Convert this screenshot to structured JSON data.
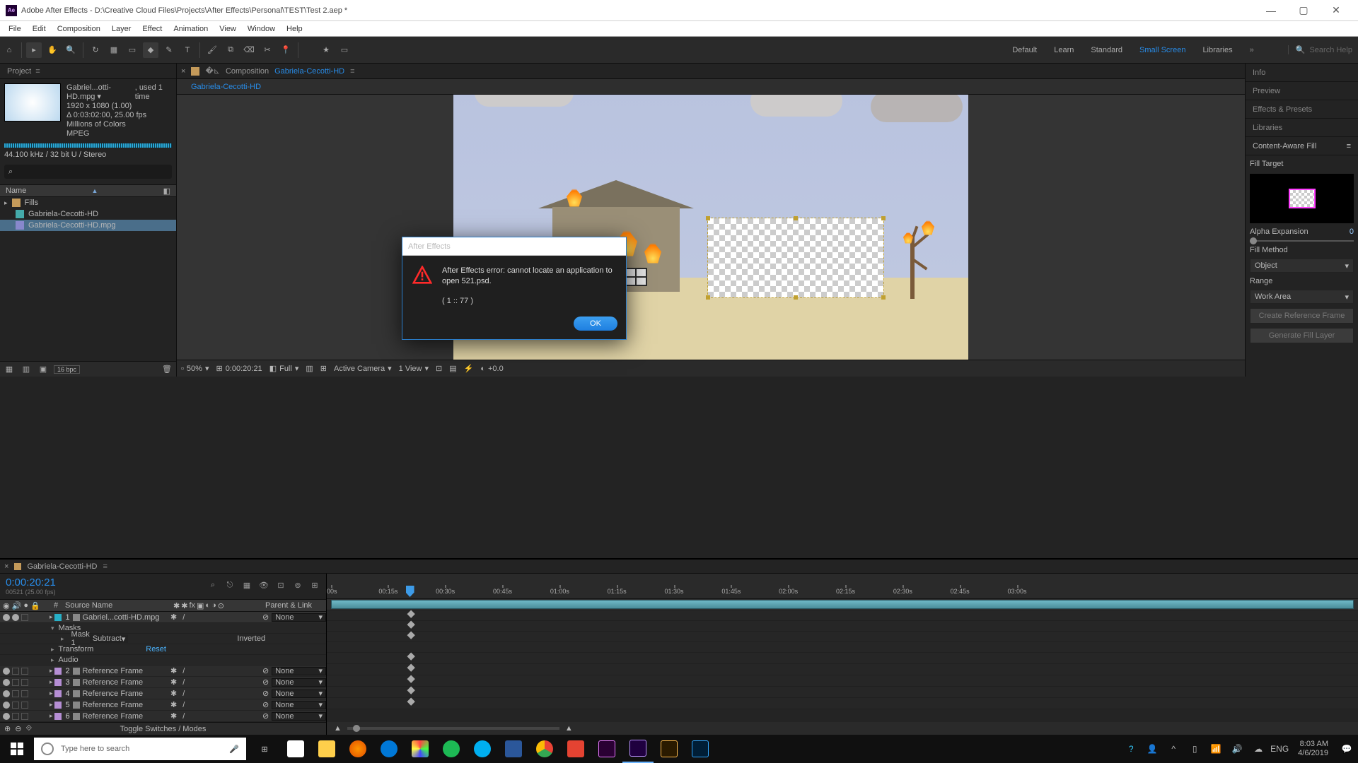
{
  "window_title": "Adobe After Effects - D:\\Creative Cloud Files\\Projects\\After Effects\\Personal\\TEST\\Test 2.aep *",
  "menu": [
    "File",
    "Edit",
    "Composition",
    "Layer",
    "Effect",
    "Animation",
    "View",
    "Window",
    "Help"
  ],
  "workspaces": [
    "Default",
    "Learn",
    "Standard",
    "Small Screen",
    "Libraries"
  ],
  "workspace_active": "Small Screen",
  "search_help_placeholder": "Search Help",
  "project": {
    "panel": "Project",
    "asset": {
      "name": "Gabriel...otti-HD.mpg ▾",
      "used": ", used 1 time",
      "res": "1920 x 1080 (1.00)",
      "dur": "Δ 0:03:02:00, 25.00 fps",
      "colors": "Millions of Colors",
      "codec": "MPEG",
      "audio": "44.100 kHz / 32 bit U / Stereo"
    },
    "search_placeholder": "",
    "col_name": "Name",
    "items": [
      {
        "type": "folder",
        "label": "Fills"
      },
      {
        "type": "comp",
        "label": "Gabriela-Cecotti-HD"
      },
      {
        "type": "mpg",
        "label": "Gabriela-Cecotti-HD.mpg"
      }
    ],
    "bpc": "16 bpc"
  },
  "composition": {
    "label": "Composition",
    "name": "Gabriela-Cecotti-HD",
    "tab": "Gabriela-Cecotti-HD"
  },
  "viewer_footer": {
    "zoom": "50%",
    "time": "0:00:20:21",
    "res": "Full",
    "camera": "Active Camera",
    "view": "1 View",
    "exposure": "+0.0"
  },
  "side_panels": [
    "Info",
    "Preview",
    "Effects & Presets",
    "Libraries"
  ],
  "caf": {
    "title": "Content-Aware Fill",
    "fill_target": "Fill Target",
    "alpha_label": "Alpha Expansion",
    "alpha_value": "0",
    "fill_method": "Fill Method",
    "fill_method_value": "Object",
    "range": "Range",
    "range_value": "Work Area",
    "btn1": "Create Reference Frame",
    "btn2": "Generate Fill Layer"
  },
  "timeline": {
    "tab": "Gabriela-Cecotti-HD",
    "timecode": "0:00:20:21",
    "timecode_sub": "00521 (25.00 fps)",
    "col_source": "Source Name",
    "col_parent": "Parent & Link",
    "toggle_label": "Toggle Switches / Modes",
    "layers": [
      {
        "n": "1",
        "name": "Gabriel...cotti-HD.mpg",
        "color": "c",
        "parent": "None",
        "sel": true
      },
      {
        "n": "2",
        "name": "Reference Frame",
        "color": "p",
        "parent": "None"
      },
      {
        "n": "3",
        "name": "Reference Frame",
        "color": "p",
        "parent": "None"
      },
      {
        "n": "4",
        "name": "Reference Frame",
        "color": "p",
        "parent": "None"
      },
      {
        "n": "5",
        "name": "Reference Frame",
        "color": "p",
        "parent": "None"
      },
      {
        "n": "6",
        "name": "Reference Frame",
        "color": "p",
        "parent": "None"
      }
    ],
    "sub": {
      "masks": "Masks",
      "mask1": "Mask 1",
      "mask_mode": "Subtract",
      "mask_inv": "Inverted",
      "transform": "Transform",
      "reset": "Reset",
      "audio": "Audio"
    },
    "ruler": [
      ":00s",
      "00:15s",
      "00:30s",
      "00:45s",
      "01:00s",
      "01:15s",
      "01:30s",
      "01:45s",
      "02:00s",
      "02:15s",
      "02:30s",
      "02:45s",
      "03:00s"
    ]
  },
  "dialog": {
    "title": "After Effects",
    "message": "After Effects error: cannot locate an application to open 521.psd.",
    "code": "( 1 :: 77 )",
    "ok": "OK"
  },
  "taskbar": {
    "search_placeholder": "Type here to search",
    "lang": "ENG",
    "time": "8:03 AM",
    "date": "4/6/2019"
  }
}
